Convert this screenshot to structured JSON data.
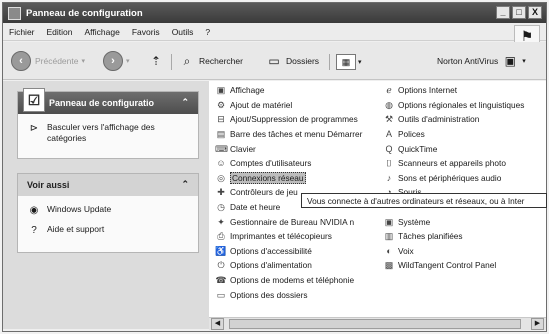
{
  "window": {
    "title": "Panneau de configuration",
    "controls": [
      "_",
      "□",
      "X"
    ]
  },
  "menubar": [
    "Fichier",
    "Edition",
    "Affichage",
    "Favoris",
    "Outils",
    "?"
  ],
  "toolbar": {
    "back": "Précédente",
    "search": "Rechercher",
    "folders": "Dossiers",
    "antivirus": "Norton AntiVirus"
  },
  "leftpane": {
    "control_panel": {
      "title": "Panneau de configuratio",
      "switch_link": "Basculer vers l'affichage des catégories"
    },
    "see_also": {
      "title": "Voir aussi",
      "links": [
        "Windows Update",
        "Aide et support"
      ]
    }
  },
  "items_col1": [
    {
      "label": "Affichage",
      "icon": "display-icon"
    },
    {
      "label": "Ajout de matériel",
      "icon": "hardware-icon"
    },
    {
      "label": "Ajout/Suppression de programmes",
      "icon": "programs-icon"
    },
    {
      "label": "Barre des tâches et menu Démarrer",
      "icon": "taskbar-icon"
    },
    {
      "label": "Clavier",
      "icon": "keyboard-icon"
    },
    {
      "label": "Comptes d'utilisateurs",
      "icon": "users-icon"
    },
    {
      "label": "Connexions réseau",
      "icon": "network-icon"
    },
    {
      "label": "Contrôleurs de jeu",
      "icon": "gamepad-icon"
    },
    {
      "label": "Date et heure",
      "icon": "clock-icon"
    },
    {
      "label": "Gestionnaire de Bureau NVIDIA n",
      "icon": "nvidia-icon"
    },
    {
      "label": "Imprimantes et télécopieurs",
      "icon": "printer-icon"
    },
    {
      "label": "Options d'accessibilité",
      "icon": "accessibility-icon"
    },
    {
      "label": "Options d'alimentation",
      "icon": "power-icon"
    },
    {
      "label": "Options de modems et téléphonie",
      "icon": "modem-icon"
    },
    {
      "label": "Options des dossiers",
      "icon": "folder-options-icon"
    }
  ],
  "items_col2": [
    {
      "label": "Options Internet",
      "icon": "internet-icon"
    },
    {
      "label": "Options régionales et linguistiques",
      "icon": "globe-icon"
    },
    {
      "label": "Outils d'administration",
      "icon": "admin-tools-icon"
    },
    {
      "label": "Polices",
      "icon": "fonts-icon"
    },
    {
      "label": "QuickTime",
      "icon": "quicktime-icon"
    },
    {
      "label": "Scanneurs et appareils photo",
      "icon": "scanner-icon"
    },
    {
      "label": "Sons et périphériques audio",
      "icon": "speaker-icon"
    },
    {
      "label": "Souris",
      "icon": "mouse-icon"
    },
    {
      "label": "",
      "icon": ""
    },
    {
      "label": "Système",
      "icon": "system-icon"
    },
    {
      "label": "Tâches planifiées",
      "icon": "tasks-icon"
    },
    {
      "label": "Voix",
      "icon": "voice-icon"
    },
    {
      "label": "WildTangent Control Panel",
      "icon": "wildtangent-icon"
    }
  ],
  "tooltip": "Vous connecte à d'autres ordinateurs et réseaux, ou à Inter"
}
